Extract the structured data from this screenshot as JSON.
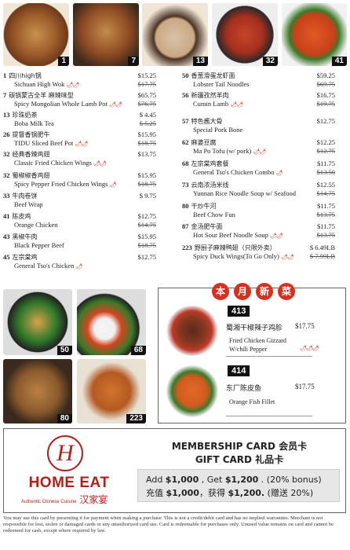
{
  "photos": [
    {
      "num": "1"
    },
    {
      "num": "7"
    },
    {
      "num": "13"
    },
    {
      "num": "32"
    },
    {
      "num": "41"
    }
  ],
  "menu_left": [
    {
      "n": "1",
      "zh": "四川high锅",
      "price": "$15.25",
      "en": "Sichuan High Wok",
      "old": "$17.75",
      "spicy": "🌶🌶"
    },
    {
      "n": "7",
      "zh": "碳锅蒙古全羊 麻辣味型",
      "price": "$65.75",
      "en": "Spicy Mongolian Whole Lamb Pot",
      "old": "$76.75",
      "spicy": "🌶🌶"
    },
    {
      "n": "13",
      "zh": "珍珠奶茶",
      "price": "$ 4.45",
      "en": "Boba Milk Tea",
      "old": "$ 5.25",
      "spicy": ""
    },
    {
      "n": "26",
      "zh": "提督香锅肥牛",
      "price": "$15.95",
      "en": "TIDU Sliced Beef Pot",
      "old": "$18.75",
      "spicy": "🌶🌶"
    },
    {
      "n": "32",
      "zh": "经典香辣鸡翅",
      "price": "$13.75",
      "en": "Classic Fried Chicken Wings",
      "old": "",
      "spicy": "🌶🌶"
    },
    {
      "n": "32",
      "zh": "蜀椒椒香鸡翅",
      "price": "$15.95",
      "en": "Spicy Pepper Fried Chicken Wings",
      "old": "$18.75",
      "spicy": "🌶"
    },
    {
      "n": "33",
      "zh": "牛肉卷饼",
      "price": "$ 9.75",
      "en": "Beef Wrap",
      "old": "",
      "spicy": ""
    },
    {
      "n": "41",
      "zh": "陈皮鸡",
      "price": "$12.75",
      "en": "Orange Chicken",
      "old": "$14.75",
      "spicy": ""
    },
    {
      "n": "43",
      "zh": "黑椒牛肉",
      "price": "$15.95",
      "en": "Black Pepper Beef",
      "old": "$18.75",
      "spicy": ""
    },
    {
      "n": "45",
      "zh": "左宗棠鸡",
      "price": "$12.75",
      "en": "General Tso's Chicken",
      "old": "",
      "spicy": "🌶"
    }
  ],
  "menu_right": [
    {
      "n": "50",
      "zh": "香葱滑蛋龙虾面",
      "price": "$59.25",
      "en": "Lobster Tail Noodles",
      "old": "$69.75",
      "spicy": ""
    },
    {
      "n": "56",
      "zh": "新疆孜然羊肉",
      "price": "$16.75",
      "en": "Cumin Lamb",
      "old": "$19.75",
      "spicy": "🌶🌶"
    },
    {
      "n": "57",
      "zh": "特色酱大骨",
      "price": "$12.75",
      "en": "Special Pork Bone",
      "old": "",
      "spicy": ""
    },
    {
      "n": "62",
      "zh": "麻婆豆腐",
      "price": "$12.25",
      "en": "Ma Po Tofu (w/ pork)",
      "old": "$12.75",
      "spicy": "🌶🌶"
    },
    {
      "n": "68",
      "zh": "左宗棠鸡套餐",
      "price": "$11.75",
      "en": "General Tso's Chicken Combo",
      "old": "$13.50",
      "spicy": "🌶"
    },
    {
      "n": "73",
      "zh": "云南浓汤米线",
      "price": "$12.55",
      "en": "Yunnan Rice Noodle Soup w/ Seafood",
      "old": "$14.75",
      "spicy": ""
    },
    {
      "n": "80",
      "zh": "干炒牛河",
      "price": "$11.75",
      "en": "Beef Chow Fun",
      "old": "$13.75",
      "spicy": ""
    },
    {
      "n": "87",
      "zh": "金汤肥牛面",
      "price": "$11.75",
      "en": "Hot Sour Beef Noodle Soup",
      "old": "$13.75",
      "spicy": "🌶🌶"
    },
    {
      "n": "223",
      "zh": "野厨子麻辣鸭翅（只限外卖）",
      "price": "$ 6.49LB",
      "en": "Spicy Duck Wings(To Go Only)",
      "old": "$ 7.99LB",
      "spicy": "🌶🌶"
    }
  ],
  "bottom_photos": [
    {
      "num": "50"
    },
    {
      "num": "68"
    },
    {
      "num": "80"
    },
    {
      "num": "223"
    }
  ],
  "monthly": {
    "badges": [
      "本",
      "月",
      "新",
      "菜"
    ],
    "items": [
      {
        "num": "413",
        "zh": "蜀湘干椒辣子鸡胗",
        "price": "$17.75",
        "en1": "Fried Chicken Gizzard",
        "en2": "W/chili Pepper",
        "spicy": "🌶🌶🌶"
      },
      {
        "num": "414",
        "zh": "东厂陈皮鱼",
        "price": "$17.75",
        "en1": "Orange Fish Fillet",
        "en2": "",
        "spicy": ""
      }
    ]
  },
  "card": {
    "logo_letter": "H",
    "logo_en": "HOME EAT",
    "logo_sub": "Authentic Chinese Cuisine",
    "logo_zh": "汉家宴",
    "title1": "MEMBERSHIP CARD 会员卡",
    "title2": "GIFT CARD 礼品卡",
    "offer_en_a": "Add ",
    "offer_en_b": "$1,000",
    "offer_en_c": " , Get ",
    "offer_en_d": "$1,200",
    "offer_en_e": " . (20% bonus)",
    "offer_zh_a": "充值 ",
    "offer_zh_b": "$1,000",
    "offer_zh_c": "，获得 ",
    "offer_zh_d": "$1,200.",
    "offer_zh_e": " (赠送 20%)"
  },
  "fineprint": "You may use this card by presenting it for payment when making a purchase. This is not a credit/debit card and has no implied warranties. Merchant is not responsible for lost, stolen or damaged cards or any unauthorized card use. Card is redeemable for purchases only. Unused value remains on card and cannot be redeemed for cash, except where required by law.",
  "colors": {
    "accent": "#d8301f",
    "brand": "#b3201c"
  }
}
